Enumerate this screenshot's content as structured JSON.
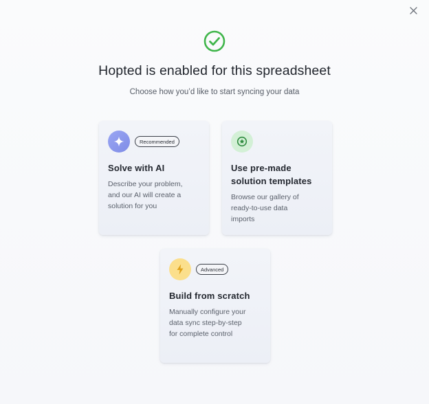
{
  "dialog": {
    "close_label": "×",
    "headline": "Hopted is enabled for this spreadsheet",
    "subline": "Choose how you’d like to start syncing your data"
  },
  "cards": [
    {
      "id": "ai",
      "icon": "sparkle-icon",
      "badge": "Recommended",
      "title_lines": [
        "Solve with AI"
      ],
      "desc_lines": [
        "Describe your problem,",
        "and our AI will create a",
        "solution for you"
      ],
      "accent": "#8590ea"
    },
    {
      "id": "templates",
      "icon": "star-badge-icon",
      "badge": "",
      "title_lines": [
        "Use pre-made",
        "solution templates"
      ],
      "desc_lines": [
        "Browse our gallery of",
        "ready-to-use data",
        "imports"
      ],
      "accent": "#2e8b3e"
    },
    {
      "id": "scratch",
      "icon": "lightning-icon",
      "badge": "Advanced",
      "title_lines": [
        "Build from scratch"
      ],
      "desc_lines": [
        "Manually configure your",
        "data sync step-by-step",
        "for complete control"
      ],
      "accent": "#e0a21a"
    }
  ],
  "colors": {
    "success_check": "#3fb54a",
    "background": "#f8f9fb"
  }
}
